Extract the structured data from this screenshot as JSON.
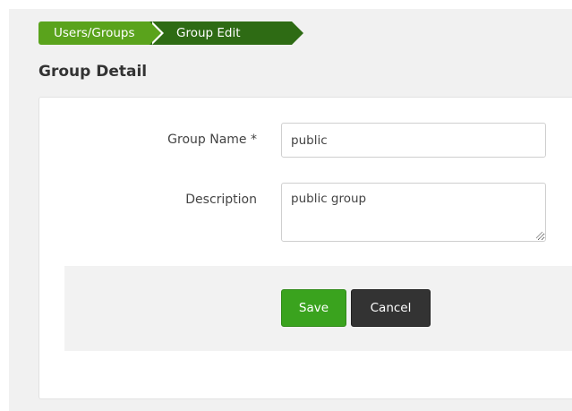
{
  "breadcrumb": {
    "items": [
      {
        "label": "Users/Groups"
      },
      {
        "label": "Group Edit"
      }
    ]
  },
  "page": {
    "title": "Group Detail"
  },
  "form": {
    "group_name": {
      "label": "Group Name *",
      "value": "public"
    },
    "description": {
      "label": "Description",
      "value": "public group"
    }
  },
  "actions": {
    "save_label": "Save",
    "cancel_label": "Cancel"
  },
  "colors": {
    "breadcrumb_active": "#5aa31c",
    "breadcrumb_current": "#2e6b14",
    "save_button": "#3aa31e",
    "cancel_button": "#333333"
  }
}
